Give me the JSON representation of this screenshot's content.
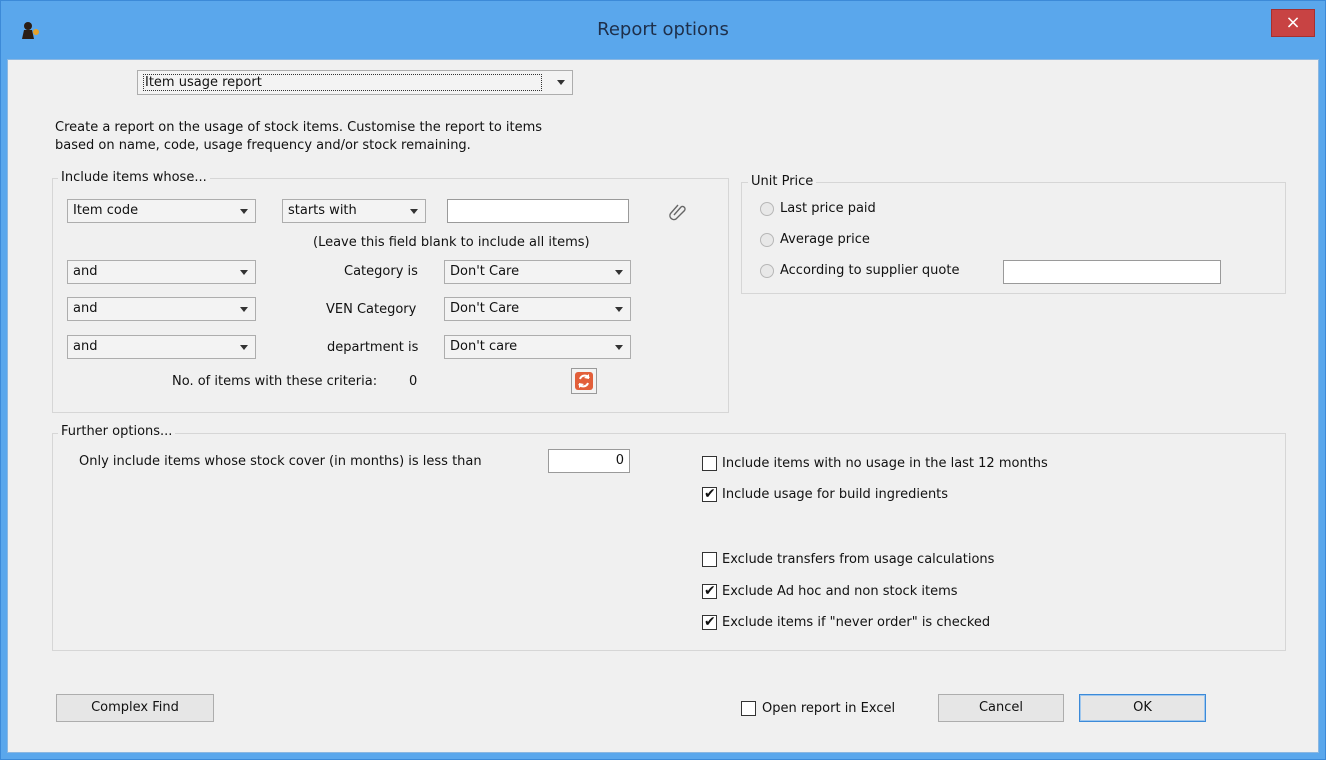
{
  "window": {
    "title": "Report options",
    "close_symbol": "×",
    "app_icon": "mSupply-icon",
    "accent": "#5aa7ec",
    "close_color": "#c84343"
  },
  "report_selector": {
    "value": "Item usage report"
  },
  "description": "Create a report on the usage of stock items.  Customise the report to items based on name, code, usage frequency and/or stock remaining.",
  "description_lines": [
    "Create a report on the usage of stock items.  Customise the report to items",
    "based on name, code, usage frequency and/or stock remaining."
  ],
  "include_items": {
    "title": "Include items whose...",
    "field_select": "Item code",
    "operator_select": "starts with",
    "search_value": "",
    "hint": "(Leave this field blank to include all items)",
    "rows": [
      {
        "conj": "and",
        "label": "Category is",
        "value": "Don't Care"
      },
      {
        "conj": "and",
        "label": "VEN Category",
        "value": "Don't Care"
      },
      {
        "conj": "and",
        "label": "department is",
        "value": "Don't care"
      }
    ],
    "count_label": "No. of items with these criteria:",
    "count_value": "0"
  },
  "unit_price": {
    "title": "Unit Price",
    "options": [
      "Last price paid",
      "Average price",
      "According to supplier quote"
    ],
    "quote_value": ""
  },
  "further": {
    "title": "Further options...",
    "stock_cover_label": "Only include items whose stock cover (in months) is less than",
    "stock_cover_value": "0",
    "checks": [
      {
        "label": "Include items with no usage in the last 12 months",
        "checked": false
      },
      {
        "label": "Include usage for build ingredients",
        "checked": true
      },
      {
        "label": "Exclude transfers from usage calculations",
        "checked": false
      },
      {
        "label": "Exclude Ad hoc and non stock items",
        "checked": true
      },
      {
        "label": "Exclude items if \"never order\" is checked",
        "checked": true
      }
    ]
  },
  "footer": {
    "complex_find": "Complex Find",
    "open_excel": "Open report in Excel",
    "open_excel_checked": false,
    "cancel": "Cancel",
    "ok": "OK"
  },
  "check_mark": "✔"
}
